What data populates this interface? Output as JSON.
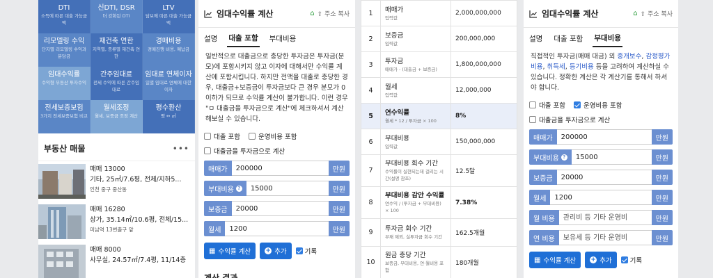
{
  "panel1": {
    "grid": [
      {
        "title": "DTI",
        "sub": "소득에 따른 대출 가능금액"
      },
      {
        "title": "신DTI, DSR",
        "sub": "더 강화된 DTI"
      },
      {
        "title": "LTV",
        "sub": "담보에 따른 대출 가능금액"
      },
      {
        "title": "리모델링 수익",
        "sub": "단지별 리모델링 수익과 분담금"
      },
      {
        "title": "재건축 연한",
        "sub": "지역별, 종류별 재건축 연한"
      },
      {
        "title": "경매비용",
        "sub": "경매진행 비용, 예납금"
      },
      {
        "title": "임대수익률",
        "sub": "수익형 부동산 투자수익"
      },
      {
        "title": "간주임대료",
        "sub": "전세 수익에 따른 간주임대료"
      },
      {
        "title": "임대료 연체이자",
        "sub": "일별 임대료 연체에 대한 이자"
      },
      {
        "title": "전세보증보험",
        "sub": "3가지 전세보증보험 비교"
      },
      {
        "title": "월세조정",
        "sub": "월세, 보증금 조정 계산"
      },
      {
        "title": "평수환산",
        "sub": "평 ↔ ㎡"
      }
    ],
    "section_title": "부동산 매물",
    "more": "•••",
    "props": [
      {
        "l1": "매매 13000",
        "l2": "기타, 25㎡/7.6평, 전체/지하5...",
        "l3": "인천 중구 중산동"
      },
      {
        "l1": "매매 16280",
        "l2": "상가, 35.14㎡/10.6평, 전체/15...",
        "l3": "미남역 13번출구 앞"
      },
      {
        "l1": "매매 8000",
        "l2": "사무실, 24.57㎡/7.4평, 11/14층",
        "l3": ""
      }
    ]
  },
  "calc": {
    "title": "임대수익률 계산",
    "share": "주소 복사",
    "tabs": [
      "설명",
      "대출 포함",
      "부대비용"
    ],
    "calc_btn": "수익률 계산",
    "add_btn": "추가",
    "record": "기록",
    "suffix": "만원"
  },
  "panel2": {
    "desc": "일반적으로 대출금으로 충당한 투자금은 투자금(분모)에 포함시키지 않고 이자에 대해서만 수익률 계산에 포함시킵니다. 하지만 전액을 대출로 충당한 경우, 대출금+보증금이 투자금보다 큰 경우 분모가 0이하가 되므로 수익률 계산이 불가합니다. 이런 경우 \"ㅁ 대출금을 투자금으로 계산\"에 체크하셔서 계산해보실 수 있습니다.",
    "chk_loan": "대출 포함",
    "chk_op": "운영비용 포함",
    "chk_invest": "대출금을 투자금으로 계산",
    "fields": [
      {
        "label": "매매가",
        "value": "200000"
      },
      {
        "label": "부대비용",
        "value": "15000"
      },
      {
        "label": "보증금",
        "value": "20000"
      },
      {
        "label": "월세",
        "value": "1200"
      }
    ],
    "cut_text": "계산 결과"
  },
  "panel3": {
    "rows": [
      {
        "n": "1",
        "l": "매매가",
        "s": "입력값",
        "v": "2,000,000,000"
      },
      {
        "n": "2",
        "l": "보증금",
        "s": "입력값",
        "v": "200,000,000"
      },
      {
        "n": "3",
        "l": "투자금",
        "s": "매매가 - (대출금 + 보증금)",
        "v": "1,800,000,000"
      },
      {
        "n": "4",
        "l": "월세",
        "s": "입력값",
        "v": "12,000,000"
      },
      {
        "n": "5",
        "l": "연수익률",
        "s": "월세 * 12 / 투자금 × 100",
        "v": "8%"
      },
      {
        "n": "6",
        "l": "부대비용",
        "s": "입력값",
        "v": "150,000,000"
      },
      {
        "n": "7",
        "l": "부대비용 회수 기간",
        "s": "수익률이 실현되는데 걸리는 시간(설명 참조)",
        "v": "12.5달"
      },
      {
        "n": "8",
        "l": "부대비용 감안 수익률",
        "s": "연수익 / (투자금 + 부대비용) × 100",
        "v": "7.38%"
      },
      {
        "n": "9",
        "l": "투자금 회수 기간",
        "s": "부채 제외, 실투자금 회수 기간",
        "v": "162.5개월"
      },
      {
        "n": "10",
        "l": "원금 충당 기간",
        "s": "보증금, 부대비용, 연·월비용 포함",
        "v": "180개월"
      }
    ]
  },
  "panel4": {
    "desc_a": "직접적인 투자금(매매 대금) 외 ",
    "link1": "중개보수",
    "sep1": ", ",
    "link2": "감정평가 비용",
    "sep2": ", ",
    "link3": "취득세",
    "sep3": ", ",
    "link4": "등기비용",
    "desc_b": " 등을 고려하여 계산하실 수 있습니다. 정확한 계산은 각 계산기를 통해서 하셔야 합니다.",
    "chk_loan": "대출 포함",
    "chk_op": "운영비용 포함",
    "chk_invest": "대출금을 투자금으로 계산",
    "fields": [
      {
        "label": "매매가",
        "value": "200000"
      },
      {
        "label": "부대비용",
        "value": "15000"
      },
      {
        "label": "보증금",
        "value": "20000"
      },
      {
        "label": "월세",
        "value": "1200"
      }
    ],
    "extra": [
      {
        "label": "월 비용",
        "placeholder": "관리비 등 기타 운영비"
      },
      {
        "label": "연 비용",
        "placeholder": "보유세 등 기타 운영비"
      }
    ]
  },
  "colors": {
    "accent": "#1f6fd6",
    "input_label": "#6b8fd1",
    "grid": "#4470b8"
  }
}
